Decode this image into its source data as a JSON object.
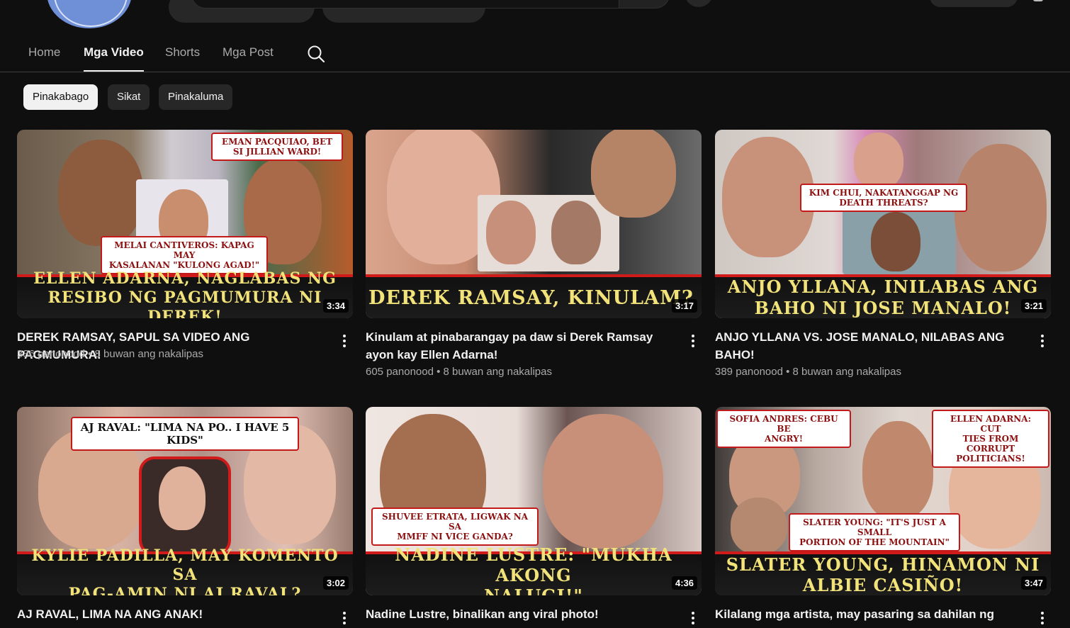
{
  "tabs": [
    "Home",
    "Mga Video",
    "Shorts",
    "Mga Post"
  ],
  "active_tab": "Mga Video",
  "chips": [
    "Pinakabago",
    "Sikat",
    "Pinakaluma"
  ],
  "videos": [
    {
      "title": "DEREK RAMSAY, SAPUL SA VIDEO ANG PAGMUMURA!",
      "views": "336 panonood",
      "age": "8 buwan ang nakalipas",
      "duration": "3:34",
      "headline": "ELLEN ADARNA, NAGLABAS NG\nRESIBO NG PAGMUMURA NI DEREK!",
      "callouts": [
        "EMAN PACQUIAO, BET\nSI JILLIAN WARD!",
        "MELAI CANTIVEROS: KAPAG MAY\nKASALANAN \"KULONG AGAD!\""
      ]
    },
    {
      "title": "Kinulam at pinabarangay pa daw si Derek Ramsay ayon kay Ellen Adarna!",
      "views": "605 panonood",
      "age": "8 buwan ang nakalipas",
      "duration": "3:17",
      "headline": "DEREK RAMSAY, KINULAM?",
      "callouts": []
    },
    {
      "title": "ANJO YLLANA VS. JOSE MANALO, NILABAS ANG BAHO!",
      "views": "389 panonood",
      "age": "8 buwan ang nakalipas",
      "duration": "3:21",
      "headline": "ANJO YLLANA, INILABAS ANG\nBAHO NI JOSE MANALO!",
      "callouts": [
        "KIM CHUI, NAKATANGGAP NG\nDEATH THREATS?"
      ]
    },
    {
      "title": "AJ RAVAL, LIMA NA ANG ANAK!",
      "views": "",
      "age": "",
      "duration": "3:02",
      "headline": "KYLIE PADILLA, MAY KOMENTO SA\nPAG-AMIN NI AJ RAVAL?",
      "callouts": [
        "AJ RAVAL: \"LIMA NA PO.. I HAVE 5\nKIDS\""
      ]
    },
    {
      "title": "Nadine Lustre, binalikan ang viral photo!",
      "views": "",
      "age": "",
      "duration": "4:36",
      "headline": "NADINE LUSTRE: \"MUKHA AKONG\nNALUGI!\"",
      "callouts": [
        "SHUVEE ETRATA, LIGWAK NA SA\nMMFF NI VICE GANDA?"
      ]
    },
    {
      "title": "Kilalang mga artista, may pasaring sa dahilan ng",
      "views": "",
      "age": "",
      "duration": "3:47",
      "headline": "SLATER YOUNG, HINAMON NI\nALBIE CASIÑO!",
      "callouts": [
        "SOFIA ANDRES: CEBU BE\nANGRY!",
        "ELLEN ADARNA: CUT\nTIES FROM CORRUPT\nPOLITICIANS!",
        "SLATER YOUNG: \"IT'S JUST A SMALL\nPORTION OF THE MOUNTAIN\""
      ]
    }
  ],
  "colors": {
    "background": "#0f0f0f",
    "chip_active": "#f1f1f1",
    "chip": "#272727",
    "headline_text": "#f2e27a",
    "ribbon_stripe": "#d11a1a"
  },
  "icons": {
    "tab_search": "search-icon",
    "more": "more-vertical-icon"
  }
}
